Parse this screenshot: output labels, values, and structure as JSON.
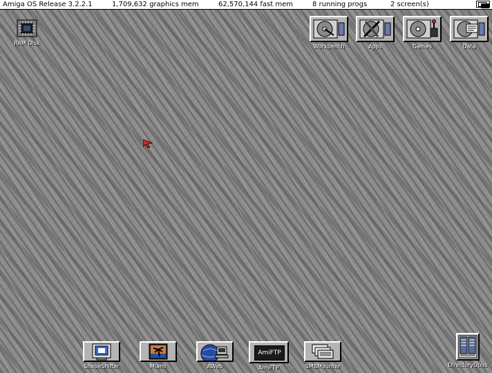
{
  "titlebar": {
    "os": "Amiga OS Release 3.2.2.1",
    "graphics_mem": "1,709,632 graphics mem",
    "fast_mem": "62,570,144 fast mem",
    "procs": "8 running progs",
    "screens": "2 screen(s)"
  },
  "desktop": {
    "ram_disk": "RAM Disk",
    "volumes": [
      "Workbench",
      "Apps",
      "Games",
      "Data"
    ],
    "dock": [
      "ShapeShifter",
      "Miami",
      "AWeb",
      "AmiFTP",
      "SMBMounter"
    ],
    "dopus": "DirectoryOpus",
    "amiftp_badge": "AmiFTP"
  }
}
